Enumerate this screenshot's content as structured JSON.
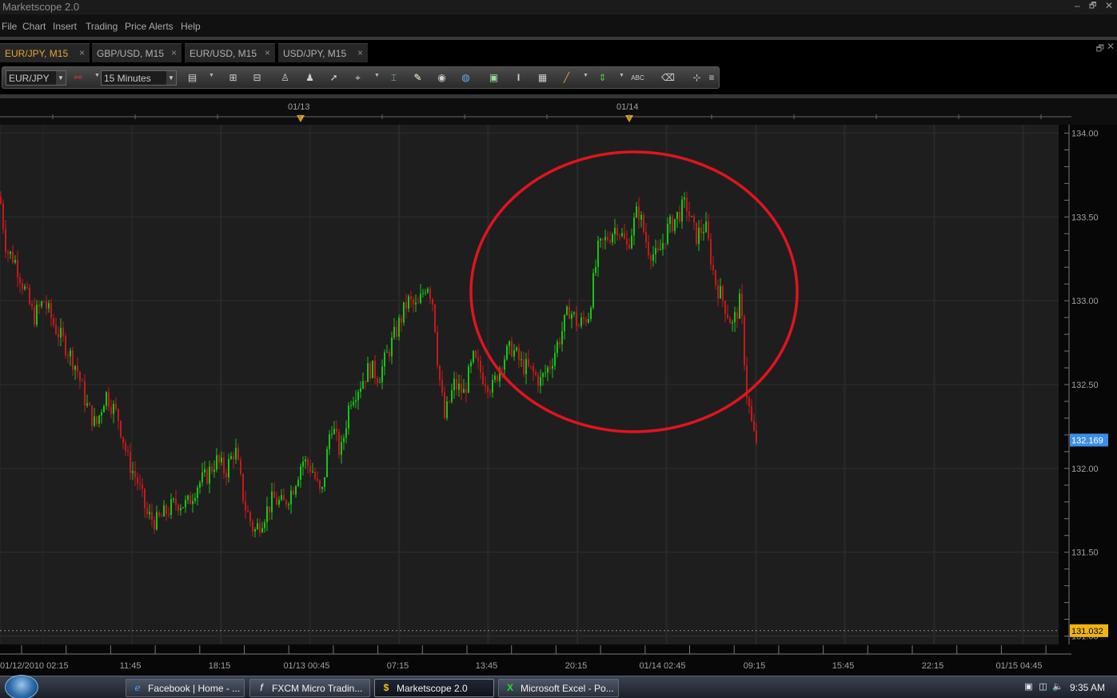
{
  "window": {
    "title": "Marketscope 2.0",
    "minimize": "–",
    "restore": "🗗",
    "close": "✕"
  },
  "menu": [
    "File",
    "Chart",
    "Insert",
    "Trading",
    "Price Alerts",
    "Help"
  ],
  "tabs": [
    {
      "label": "EUR/JPY, M15",
      "active": true
    },
    {
      "label": "GBP/USD, M15",
      "active": false
    },
    {
      "label": "EUR/USD, M15",
      "active": false
    },
    {
      "label": "USD/JPY, M15",
      "active": false
    }
  ],
  "tab_close": "×",
  "tab_controls": {
    "restore": "🗗",
    "close": "✕"
  },
  "toolbar": {
    "instrument": "EUR/JPY",
    "timeframe": "15 Minutes",
    "icons": [
      "link-icon",
      "candle-type-icon",
      "zoom-in-icon",
      "zoom-out-icon",
      "add-indicator-icon",
      "remove-indicator-icon",
      "cursor-icon",
      "crosshair-icon",
      "data-box-icon",
      "note-icon",
      "eye-icon",
      "globe-icon",
      "image-icon",
      "text-icon",
      "table-icon",
      "line-tool-icon",
      "arrow-marker-icon",
      "abc-text-icon",
      "eraser-icon",
      "grid-icon",
      "more-icon"
    ]
  },
  "chart": {
    "date_markers": [
      "01/13",
      "01/14"
    ],
    "x_labels": [
      "01/12/2010 02:15",
      "11:45",
      "18:15",
      "01/13 00:45",
      "07:15",
      "13:45",
      "20:15",
      "01/14 02:45",
      "09:15",
      "15:45",
      "22:15",
      "01/15 04:45"
    ],
    "current_price": "132.169",
    "ref_price": "131.032",
    "colors": {
      "up": "#17c417",
      "down": "#c41919",
      "bg": "#1e1e1e",
      "grid": "#2e2e2e",
      "annotation": "#e0141e",
      "current": "#3d8fe6",
      "ref": "#f0b412"
    }
  },
  "chart_data": {
    "type": "candlestick",
    "instrument": "EUR/JPY",
    "timeframe": "M15",
    "ylim": [
      130.95,
      134.05
    ],
    "yticks": [
      131.0,
      131.5,
      132.0,
      132.5,
      133.0,
      133.5,
      134.0
    ],
    "ytick_labels": [
      "131.00",
      "131.50",
      "132.00",
      "132.50",
      "133.00",
      "133.50",
      "134.00"
    ],
    "current_price": 132.169,
    "horizontal_line": 131.032,
    "price_path": [
      [
        0,
        133.62
      ],
      [
        8,
        133.3
      ],
      [
        18,
        133.25
      ],
      [
        32,
        133.05
      ],
      [
        42,
        132.9
      ],
      [
        55,
        133.0
      ],
      [
        68,
        132.85
      ],
      [
        80,
        132.75
      ],
      [
        96,
        132.6
      ],
      [
        108,
        132.38
      ],
      [
        120,
        132.25
      ],
      [
        132,
        132.45
      ],
      [
        148,
        132.3
      ],
      [
        160,
        132.05
      ],
      [
        172,
        131.92
      ],
      [
        184,
        131.72
      ],
      [
        196,
        131.68
      ],
      [
        210,
        131.75
      ],
      [
        222,
        131.8
      ],
      [
        234,
        131.78
      ],
      [
        246,
        131.9
      ],
      [
        258,
        131.95
      ],
      [
        270,
        132.05
      ],
      [
        282,
        131.98
      ],
      [
        294,
        132.12
      ],
      [
        306,
        131.78
      ],
      [
        318,
        131.62
      ],
      [
        330,
        131.72
      ],
      [
        342,
        131.82
      ],
      [
        354,
        131.78
      ],
      [
        366,
        131.88
      ],
      [
        378,
        132.05
      ],
      [
        390,
        132.0
      ],
      [
        402,
        131.82
      ],
      [
        414,
        132.28
      ],
      [
        426,
        132.08
      ],
      [
        438,
        132.42
      ],
      [
        450,
        132.5
      ],
      [
        462,
        132.6
      ],
      [
        474,
        132.55
      ],
      [
        486,
        132.7
      ],
      [
        498,
        132.85
      ],
      [
        510,
        133.0
      ],
      [
        522,
        132.95
      ],
      [
        534,
        133.12
      ],
      [
        542,
        132.98
      ],
      [
        548,
        132.6
      ],
      [
        556,
        132.3
      ],
      [
        568,
        132.5
      ],
      [
        580,
        132.45
      ],
      [
        592,
        132.65
      ],
      [
        604,
        132.55
      ],
      [
        616,
        132.48
      ],
      [
        628,
        132.65
      ],
      [
        640,
        132.72
      ],
      [
        652,
        132.62
      ],
      [
        664,
        132.58
      ],
      [
        676,
        132.52
      ],
      [
        688,
        132.62
      ],
      [
        700,
        132.78
      ],
      [
        712,
        132.95
      ],
      [
        724,
        132.85
      ],
      [
        736,
        132.92
      ],
      [
        748,
        133.3
      ],
      [
        760,
        133.38
      ],
      [
        772,
        133.45
      ],
      [
        784,
        133.32
      ],
      [
        798,
        133.55
      ],
      [
        810,
        133.32
      ],
      [
        822,
        133.25
      ],
      [
        834,
        133.42
      ],
      [
        846,
        133.5
      ],
      [
        858,
        133.58
      ],
      [
        870,
        133.38
      ],
      [
        882,
        133.45
      ],
      [
        894,
        133.12
      ],
      [
        906,
        132.98
      ],
      [
        916,
        132.85
      ],
      [
        926,
        133.0
      ],
      [
        934,
        132.45
      ],
      [
        942,
        132.2
      ],
      [
        946,
        132.17
      ]
    ],
    "annotation": {
      "type": "ellipse",
      "note": "red hand-drawn circle around the 01/14 rally and sell-off"
    }
  },
  "taskbar": {
    "items": [
      {
        "label": "Facebook | Home - ...",
        "icon": "ie-icon",
        "active": false
      },
      {
        "label": "FXCM Micro Tradin...",
        "icon": "fx-icon",
        "active": false
      },
      {
        "label": "Marketscope 2.0",
        "icon": "dollar-icon",
        "active": true
      },
      {
        "label": "Microsoft Excel - Po...",
        "icon": "excel-icon",
        "active": false
      }
    ],
    "clock": "9:35 AM"
  }
}
